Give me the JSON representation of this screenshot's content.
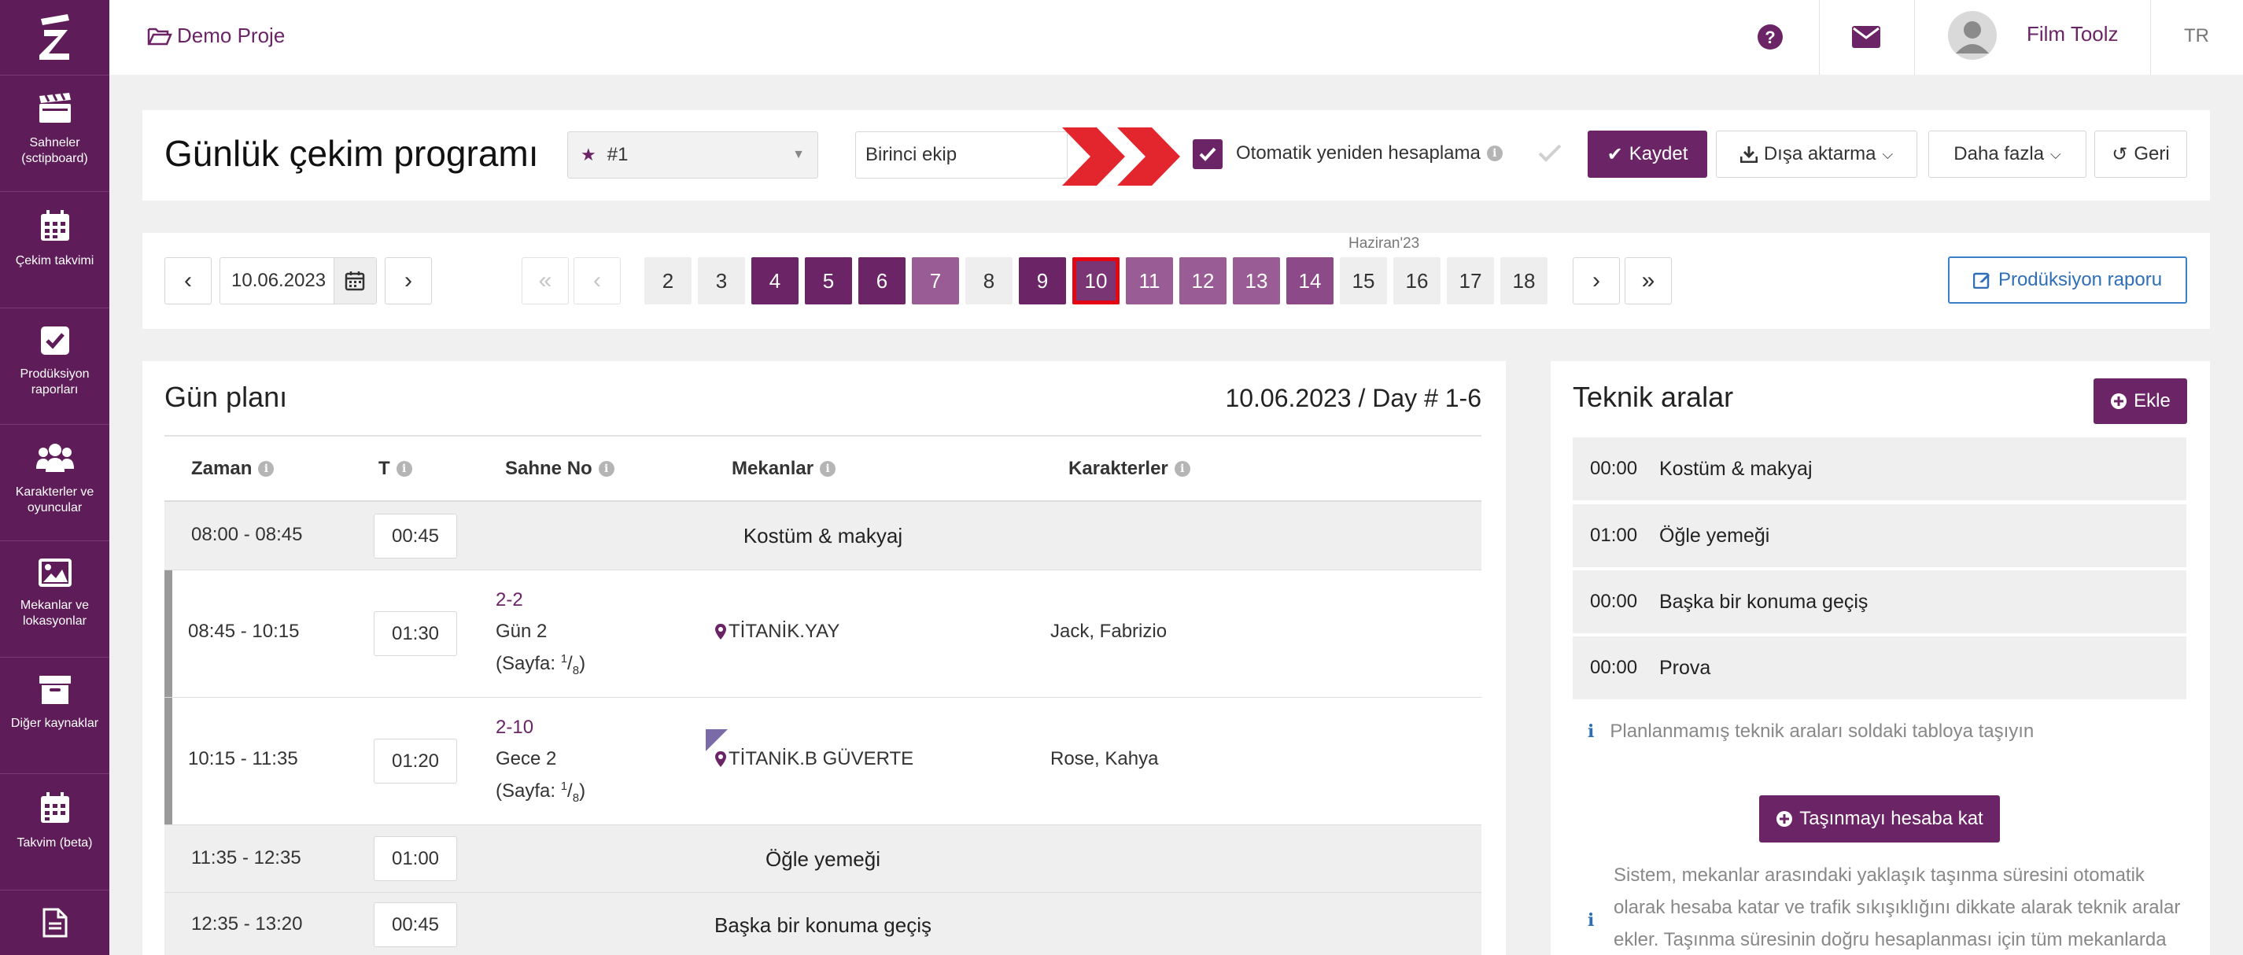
{
  "sidebar": {
    "items": [
      {
        "label": "Sahneler (sctipboard)",
        "icon": "clapperboard-icon"
      },
      {
        "label": "Çekim takvimi",
        "icon": "calendar-icon"
      },
      {
        "label": "Prodüksiyon raporları",
        "icon": "checkbox-icon"
      },
      {
        "label": "Karakterler ve oyuncular",
        "icon": "users-icon"
      },
      {
        "label": "Mekanlar ve lokasyonlar",
        "icon": "image-icon"
      },
      {
        "label": "Diğer kaynaklar",
        "icon": "archive-icon"
      },
      {
        "label": "Takvim (beta)",
        "icon": "calendar-grid-icon"
      },
      {
        "label": "",
        "icon": "document-icon"
      }
    ]
  },
  "topbar": {
    "project": "Demo Proje",
    "user": "Film Toolz",
    "lang": "TR"
  },
  "header": {
    "title": "Günlük çekim programı",
    "schedule_select": "#1",
    "crew_input": "Birinci ekip",
    "auto_recalc_label": "Otomatik yeniden hesaplama",
    "save": "Kaydet",
    "export": "Dışa aktarma",
    "more": "Daha fazla",
    "back": "Geri"
  },
  "datebar": {
    "date": "10.06.2023",
    "month_label": "Haziran'23",
    "days": [
      "2",
      "3",
      "4",
      "5",
      "6",
      "7",
      "8",
      "9",
      "10",
      "11",
      "12",
      "13",
      "14",
      "15",
      "16",
      "17",
      "18"
    ],
    "production_report": "Prodüksiyon raporu"
  },
  "dayplan": {
    "title": "Gün planı",
    "date_day": "10.06.2023 / Day # 1-6",
    "columns": {
      "time": "Zaman",
      "t": "T",
      "scene": "Sahne No",
      "locations": "Mekanlar",
      "characters": "Karakterler"
    },
    "rows": [
      {
        "time": "08:00 - 08:45",
        "dur": "00:45",
        "label": "Kostüm & makyaj"
      },
      {
        "time": "08:45 - 10:15",
        "dur": "01:30",
        "scene_no": "2-2",
        "scene_day": "Gün 2",
        "page_label": "(Sayfa:",
        "page_num": "1",
        "page_den": "8",
        "page_close": ")",
        "location": "TİTANİK.YAY",
        "characters": "Jack, Fabrizio"
      },
      {
        "time": "10:15 - 11:35",
        "dur": "01:20",
        "scene_no": "2-10",
        "scene_day": "Gece 2",
        "page_label": "(Sayfa:",
        "page_num": "1",
        "page_den": "8",
        "page_close": ")",
        "location": "TİTANİK.B GÜVERTE",
        "characters": "Rose, Kahya"
      },
      {
        "time": "11:35 - 12:35",
        "dur": "01:00",
        "label": "Öğle yemeği"
      },
      {
        "time": "12:35 - 13:20",
        "dur": "00:45",
        "label": "Başka bir konuma geçiş"
      }
    ]
  },
  "technical": {
    "title": "Teknik aralar",
    "add": "Ekle",
    "items": [
      {
        "t": "00:00",
        "label": "Kostüm & makyaj"
      },
      {
        "t": "01:00",
        "label": "Öğle yemeği"
      },
      {
        "t": "00:00",
        "label": "Başka bir konuma geçiş"
      },
      {
        "t": "00:00",
        "label": "Prova"
      }
    ],
    "hint": "Planlanmamış teknik araları soldaki tabloya taşıyın",
    "travel_button": "Taşınmayı hesaba kat",
    "description": "Sistem, mekanlar arasındaki yaklaşık taşınma süresini otomatik olarak hesaba katar ve trafik sıkışıklığını dikkate alarak teknik aralar ekler. Taşınma süresinin doğru hesaplanması için tüm mekanlarda"
  }
}
